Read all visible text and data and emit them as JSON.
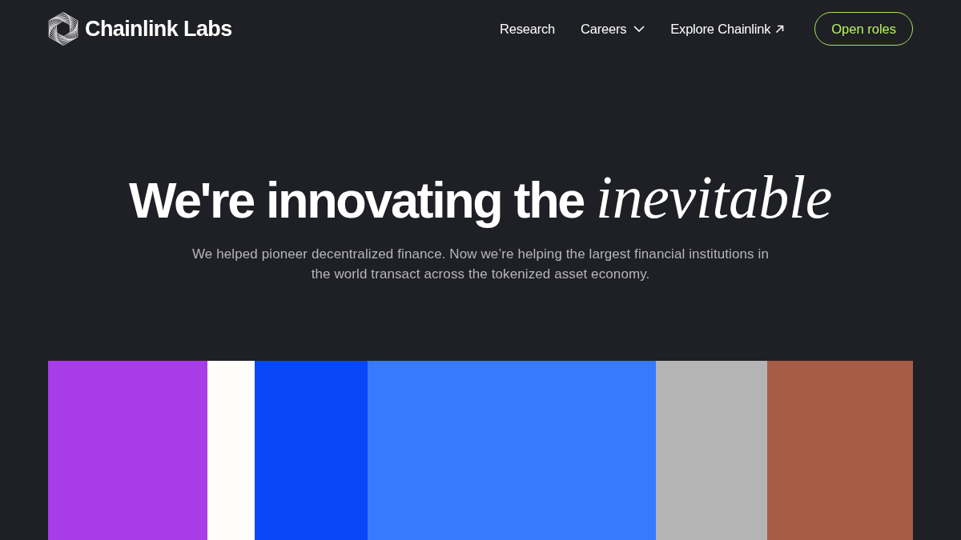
{
  "nav": {
    "brand": "Chainlink Labs",
    "links": [
      {
        "label": "Research",
        "kind": "plain"
      },
      {
        "label": "Careers",
        "kind": "dropdown"
      },
      {
        "label": "Explore Chainlink",
        "kind": "external"
      }
    ],
    "cta": "Open roles"
  },
  "hero": {
    "title": "We're innovating the *inevitable*",
    "subtitle": "We helped pioneer decentralized finance. Now we’re helping the largest financial institutions in the world transact across the tokenized asset economy."
  },
  "color_panels": [
    {
      "color": "#a73ce8"
    },
    {
      "color": "#fffdfa"
    },
    {
      "color": "#0847f7"
    },
    {
      "color": "#377aff"
    },
    {
      "color": "#b4b4b4"
    },
    {
      "color": "#a75c45"
    }
  ]
}
